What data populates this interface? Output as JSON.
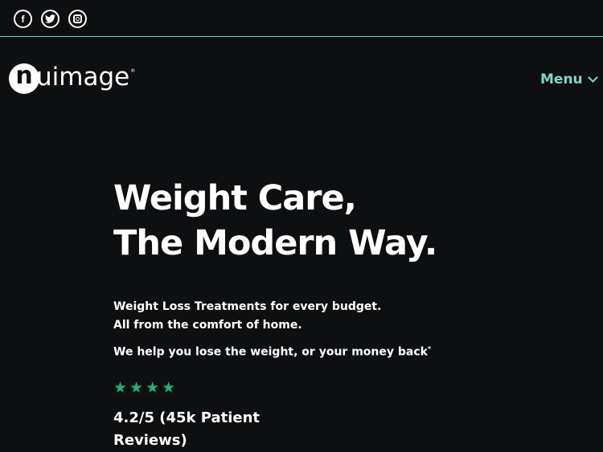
{
  "social": {
    "facebook_glyph": "f",
    "twitter_glyph": "t",
    "icons": [
      "facebook-icon",
      "twitter-icon",
      "instagram-icon"
    ]
  },
  "logo": {
    "mark": "n",
    "text": "uimage",
    "tm": "®"
  },
  "nav": {
    "menu_label": "Menu"
  },
  "hero": {
    "title_line1": "Weight Care,",
    "title_line2": "The Modern Way.",
    "subtitle_line1": "Weight Loss Treatments for every budget.",
    "subtitle_line2": "All from the comfort of home.",
    "promise": "We help you lose the weight, or your money back",
    "promise_mark": "*"
  },
  "reviews": {
    "stars": [
      "★",
      "★",
      "★",
      "★"
    ],
    "rating_line1": "4.2/5 (45k Patient",
    "rating_line2": "Reviews)"
  },
  "colors": {
    "background": "#0e0f11",
    "accent": "#7fd6c8",
    "star": "#1fb27f",
    "text": "#ffffff"
  }
}
